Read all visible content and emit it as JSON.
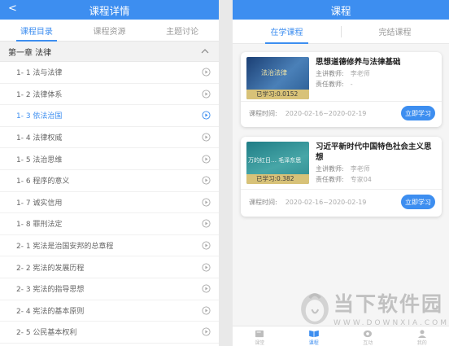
{
  "left": {
    "title": "课程详情",
    "back_glyph": "<",
    "tabs": [
      {
        "label": "课程目录"
      },
      {
        "label": "课程资源"
      },
      {
        "label": "主题讨论"
      }
    ],
    "chapter": {
      "label": "第一章 法律",
      "chevron": "chevron-up-icon"
    },
    "lessons": [
      {
        "label": "1- 1 法与法律"
      },
      {
        "label": "1- 2 法律体系"
      },
      {
        "label": "1- 3 依法治国"
      },
      {
        "label": "1- 4 法律权威"
      },
      {
        "label": "1- 5 法治思维"
      },
      {
        "label": "1- 6 程序的意义"
      },
      {
        "label": "1- 7 诚实信用"
      },
      {
        "label": "1- 8 罪刑法定"
      },
      {
        "label": "2- 1 宪法是治国安邦的总章程"
      },
      {
        "label": "2- 2 宪法的发展历程"
      },
      {
        "label": "2- 3 宪法的指导思想"
      },
      {
        "label": "2- 4 宪法的基本原则"
      },
      {
        "label": "2- 5 公民基本权利"
      }
    ],
    "active_lesson_index": 2
  },
  "right": {
    "title": "课程",
    "tabs": [
      {
        "label": "在学课程"
      },
      {
        "label": "完结课程"
      }
    ],
    "courses": [
      {
        "title": "思想道德修养与法律基础",
        "thumb_text": "法治法律",
        "progress_label": "已学习:0.0152",
        "teacher_label": "主讲教师:",
        "teacher": "李老师",
        "manager_label": "责任教师:",
        "manager": "-",
        "time_label": "课程时间:",
        "time": "2020-02-16~2020-02-19",
        "button": "立即学习"
      },
      {
        "title": "习近平新时代中国特色社会主义思想",
        "thumb_text": "万的红日… 毛泽东思",
        "progress_label": "已学习:0.382",
        "teacher_label": "主讲教师:",
        "teacher": "李老师",
        "manager_label": "责任教师:",
        "manager": "专家04",
        "time_label": "课程时间:",
        "time": "2020-02-16~2020-02-19",
        "button": "立即学习"
      }
    ],
    "bottom_nav": [
      {
        "label": "课堂",
        "icon": "book-icon"
      },
      {
        "label": "课程",
        "icon": "open-book-icon"
      },
      {
        "label": "互动",
        "icon": "chat-icon"
      },
      {
        "label": "我的",
        "icon": "person-icon"
      }
    ],
    "active_nav_index": 1
  },
  "watermark": {
    "cn": "当下软件园",
    "en": "WWW.DOWNXIA.COM"
  },
  "colors": {
    "accent": "#3d8ef0"
  }
}
